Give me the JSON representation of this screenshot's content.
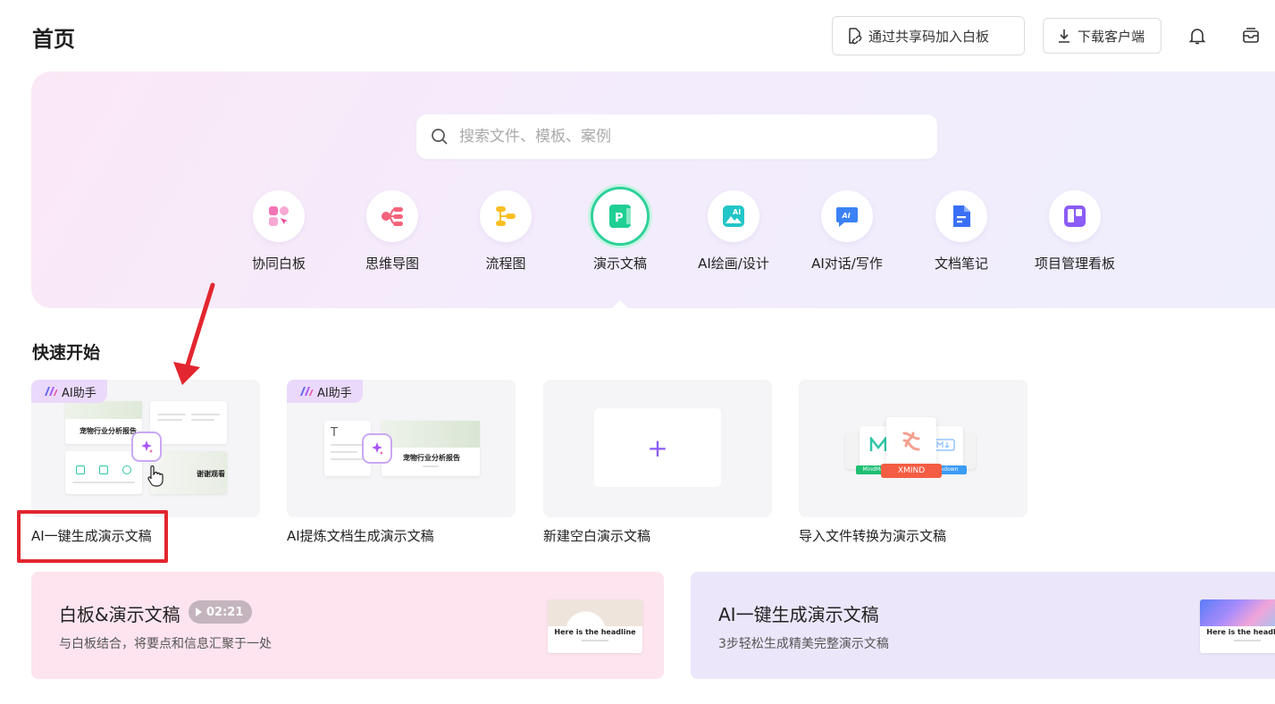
{
  "header": {
    "title": "首页",
    "join_button": "通过共享码加入白板",
    "download_button": "下载客户端"
  },
  "search": {
    "placeholder": "搜索文件、模板、案例"
  },
  "categories": [
    {
      "label": "协同白板",
      "icon": "whiteboard-icon",
      "color": "#f472b6"
    },
    {
      "label": "思维导图",
      "icon": "mindmap-icon",
      "color": "#f4637a"
    },
    {
      "label": "流程图",
      "icon": "flowchart-icon",
      "color": "#fbbf24"
    },
    {
      "label": "演示文稿",
      "icon": "presentation-icon",
      "color": "#1fcf93",
      "active": true
    },
    {
      "label": "AI绘画/设计",
      "icon": "ai-drawing-icon",
      "color": "#22c5c8"
    },
    {
      "label": "AI对话/写作",
      "icon": "ai-chat-icon",
      "color": "#3b82f6"
    },
    {
      "label": "文档笔记",
      "icon": "document-icon",
      "color": "#3b6ff6"
    },
    {
      "label": "项目管理看板",
      "icon": "kanban-icon",
      "color": "#8b5cf6"
    }
  ],
  "quick_start": {
    "title": "快速开始",
    "ai_badge": "AI助手",
    "cards": [
      {
        "label": "AI一键生成演示文稿",
        "slide_title": "宠物行业分析报告",
        "slide_title_2": "谢谢观看"
      },
      {
        "label": "AI提炼文档生成演示文稿",
        "slide_title": "宠物行业分析报告"
      },
      {
        "label": "新建空白演示文稿",
        "plus": "+"
      },
      {
        "label": "导入文件转换为演示文稿",
        "file_tags": [
          "MindMaster",
          "XMIND",
          "Markdown"
        ]
      }
    ]
  },
  "banners": [
    {
      "title": "白板&演示文稿",
      "duration": "02:21",
      "subtitle": "与白板结合，将要点和信息汇聚于一处",
      "thumb_text": "Here is the headline"
    },
    {
      "title": "AI一键生成演示文稿",
      "subtitle": "3步轻松生成精美完整演示文稿",
      "thumb_text": "Here is the headline"
    }
  ],
  "colors": {
    "accent": "#8b5cf6",
    "active_ring": "#2fd19a",
    "highlight_red": "#e3262f"
  }
}
